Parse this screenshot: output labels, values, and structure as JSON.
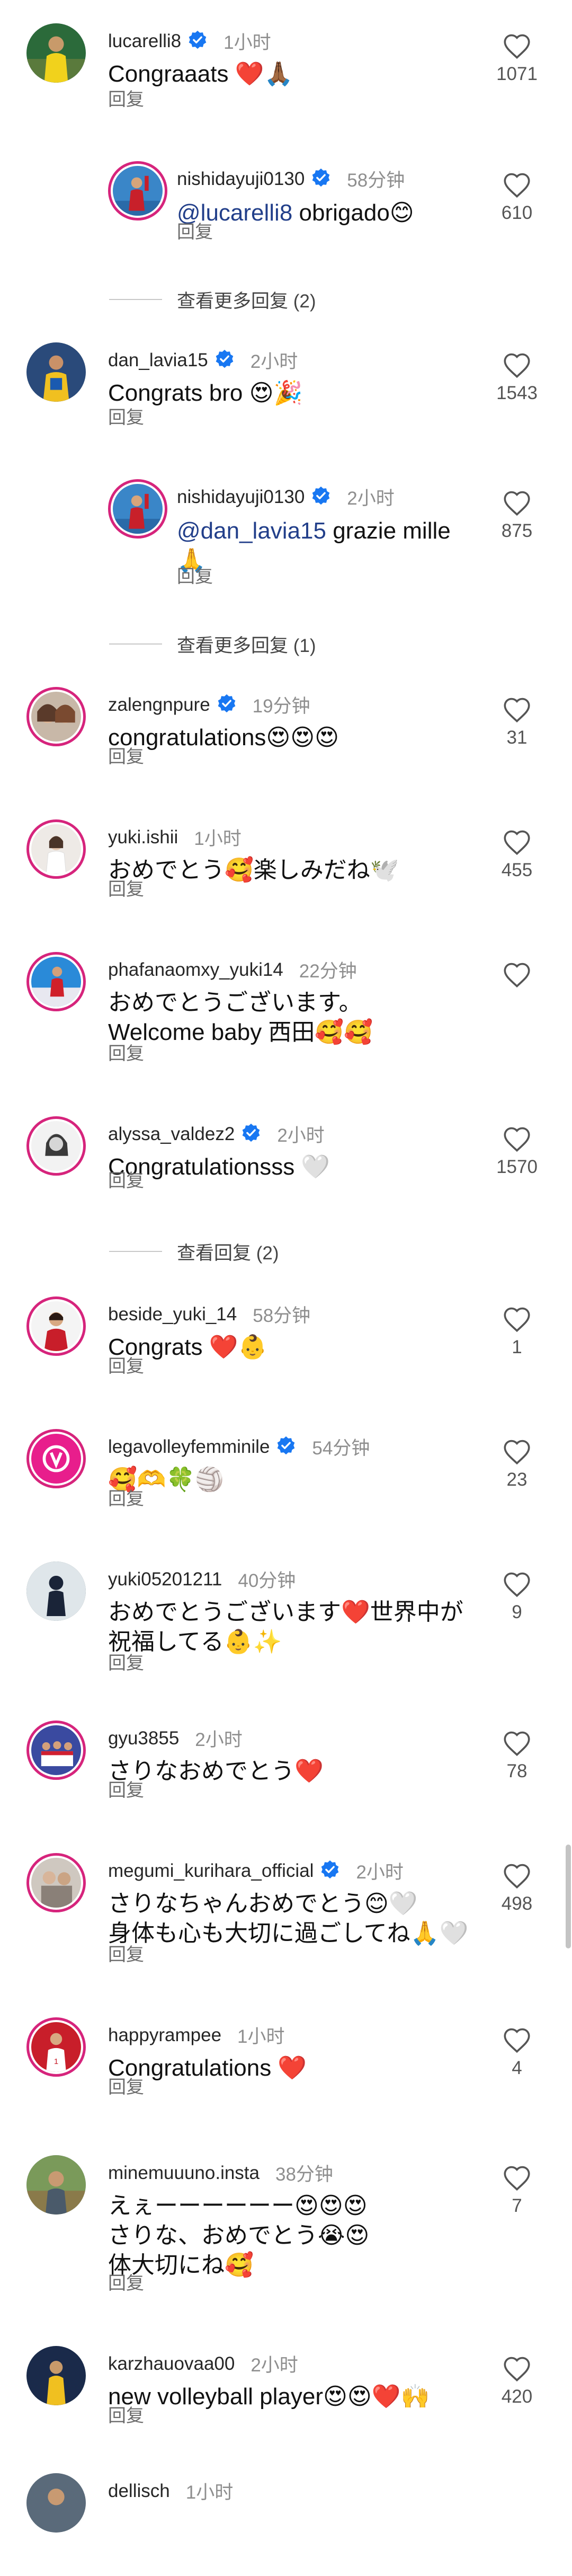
{
  "labels": {
    "reply": "回复"
  },
  "colors": {
    "verified": "#1877f2",
    "story_ring": "#d6247c",
    "mention": "#223f8a"
  },
  "comments": [
    {
      "id": "c1",
      "avatar": "player-yellow",
      "ring": false,
      "verified": true,
      "user": "lucarelli8",
      "time": "1小时",
      "text": "Congraaats ❤️🙏🏾",
      "likes": "1071"
    },
    {
      "id": "r1",
      "avatar": "player-red",
      "ring": true,
      "verified": true,
      "user": "nishidayuji0130",
      "time": "58分钟",
      "mention": "@lucarelli8",
      "text": " obrigado😊",
      "likes": "610"
    },
    {
      "id": "c2",
      "avatar": "player-blue",
      "ring": false,
      "verified": true,
      "user": "dan_lavia15",
      "time": "2小时",
      "text": "Congrats bro 😍🎉",
      "likes": "1543"
    },
    {
      "id": "r2",
      "avatar": "player-red",
      "ring": true,
      "verified": true,
      "user": "nishidayuji0130",
      "time": "2小时",
      "mention": "@dan_lavia15",
      "text": " grazie mille\n🙏",
      "likes": "875"
    },
    {
      "id": "c3",
      "avatar": "friends",
      "ring": true,
      "verified": true,
      "user": "zalengnpure",
      "time": "19分钟",
      "text": "congratulations😍😍😍",
      "likes": "31"
    },
    {
      "id": "c4",
      "avatar": "woman-white",
      "ring": true,
      "verified": false,
      "user": "yuki.ishii",
      "time": "1小时",
      "text": "おめでとう🥰楽しみだね🕊️",
      "likes": "455"
    },
    {
      "id": "c5",
      "avatar": "player-red-court",
      "ring": true,
      "verified": false,
      "user": "phafanaomxy_yuki14",
      "time": "22分钟",
      "text": "おめでとうございます。\nWelcome baby 西田🥰🥰",
      "likes": ""
    },
    {
      "id": "c6",
      "avatar": "portrait-bw",
      "ring": true,
      "verified": true,
      "user": "alyssa_valdez2",
      "time": "2小时",
      "text": "Congratulationsss 🤍",
      "likes": "1570"
    },
    {
      "id": "c7",
      "avatar": "player-red-white",
      "ring": true,
      "verified": false,
      "user": "beside_yuki_14",
      "time": "58分钟",
      "text": "Congrats ❤️👶",
      "likes": "1"
    },
    {
      "id": "c8",
      "avatar": "league-logo",
      "ring": true,
      "verified": true,
      "user": "legavolleyfemminile",
      "time": "54分钟",
      "text": "🥰🫶🍀🏐",
      "likes": "23"
    },
    {
      "id": "c9",
      "avatar": "silhouette",
      "ring": false,
      "verified": false,
      "user": "yuki05201211",
      "time": "40分钟",
      "text": "おめでとうございます❤️世界中が\n祝福してる👶✨",
      "likes": "9"
    },
    {
      "id": "c10",
      "avatar": "team-blue",
      "ring": true,
      "verified": false,
      "user": "gyu3855",
      "time": "2小时",
      "text": "さりなおめでとう❤️",
      "likes": "78"
    },
    {
      "id": "c11",
      "avatar": "group-photo",
      "ring": true,
      "verified": true,
      "user": "megumi_kurihara_official",
      "time": "2小时",
      "text": "さりなちゃんおめでとう😊🤍\n身体も心も大切に過ごしてね🙏🤍",
      "likes": "498"
    },
    {
      "id": "c12",
      "avatar": "player-white-red",
      "ring": true,
      "verified": false,
      "user": "happyrampee",
      "time": "1小时",
      "text": "Congratulations ❤️",
      "likes": "4"
    },
    {
      "id": "c13",
      "avatar": "outdoor",
      "ring": false,
      "verified": false,
      "user": "minemuuuno.insta",
      "time": "38分钟",
      "text": "えぇーーーーーー😍😍😍\nさりな、おめでとう😭😍\n体大切にね🥰",
      "likes": "7"
    },
    {
      "id": "c14",
      "avatar": "player-yellow-small",
      "ring": false,
      "verified": false,
      "user": "karzhauovaa00",
      "time": "2小时",
      "text": "new volleyball player😍😍❤️🙌",
      "likes": "420"
    },
    {
      "id": "c15",
      "avatar": "player-cut",
      "ring": false,
      "verified": false,
      "user": "dellisch",
      "time": "1小时",
      "text": "",
      "likes": ""
    }
  ],
  "more_replies": [
    {
      "id": "m1",
      "label": "查看更多回复 (2)"
    },
    {
      "id": "m2",
      "label": "查看更多回复 (1)"
    },
    {
      "id": "m3",
      "label": "查看回复 (2)"
    }
  ]
}
